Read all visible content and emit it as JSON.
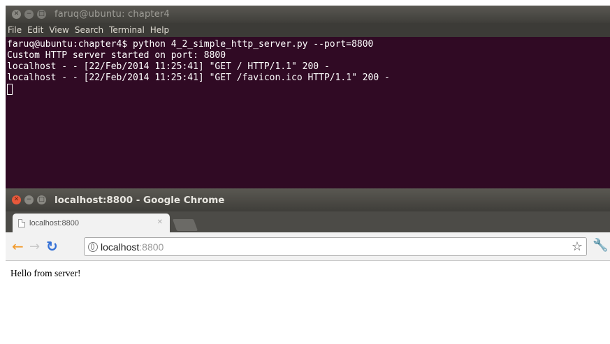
{
  "terminal": {
    "title": "faruq@ubuntu: chapter4",
    "menu": [
      "File",
      "Edit",
      "View",
      "Search",
      "Terminal",
      "Help"
    ],
    "lines": [
      "faruq@ubuntu:chapter4$ python 4_2_simple_http_server.py --port=8800",
      "Custom HTTP server started on port: 8800",
      "localhost - - [22/Feb/2014 11:25:41] \"GET / HTTP/1.1\" 200 -",
      "localhost - - [22/Feb/2014 11:25:41] \"GET /favicon.ico HTTP/1.1\" 200 -"
    ]
  },
  "browser": {
    "window_title": "localhost:8800 - Google Chrome",
    "tab_label": "localhost:8800",
    "url_host": "localhost",
    "url_port": ":8800",
    "page_text": "Hello from server!"
  },
  "icons": {
    "close": "close-icon",
    "minimize": "minimize-icon",
    "maximize": "maximize-icon",
    "back": "back-arrow-icon",
    "forward": "forward-arrow-icon",
    "reload": "reload-icon",
    "globe": "globe-icon",
    "star": "star-icon",
    "wrench": "wrench-icon"
  },
  "colors": {
    "terminal_bg": "#300a24",
    "close_button": "#e8593b",
    "back_arrow": "#f29a2c",
    "reload": "#3470d6"
  }
}
